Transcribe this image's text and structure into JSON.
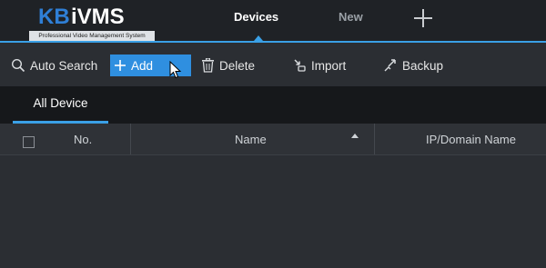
{
  "app": {
    "logo_brand": "KB",
    "logo_name": "iVMS",
    "logo_subtitle": "Professional Video Management System"
  },
  "top_tabs": {
    "devices": "Devices",
    "new": "New"
  },
  "toolbar": {
    "auto_search": "Auto Search",
    "add": "Add",
    "delete": "Delete",
    "import": "Import",
    "backup": "Backup"
  },
  "subtabs": {
    "all_device": "All Device"
  },
  "table": {
    "columns": {
      "no": "No.",
      "name": "Name",
      "ip": "IP/Domain Name"
    },
    "rows": []
  },
  "colors": {
    "accent": "#3aa0e6",
    "add_button": "#2f8fe0",
    "header_bg": "#1f2226",
    "body_bg": "#2b2e33"
  }
}
